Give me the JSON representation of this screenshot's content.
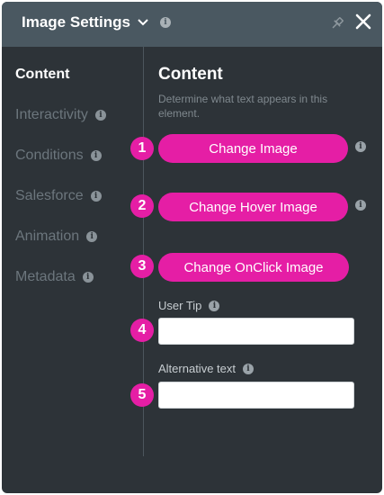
{
  "header": {
    "title": "Image Settings"
  },
  "sidebar": {
    "items": [
      {
        "label": "Content"
      },
      {
        "label": "Interactivity"
      },
      {
        "label": "Conditions"
      },
      {
        "label": "Salesforce"
      },
      {
        "label": "Animation"
      },
      {
        "label": "Metadata"
      }
    ]
  },
  "main": {
    "title": "Content",
    "description": "Determine what text appears in this element.",
    "steps": [
      "1",
      "2",
      "3",
      "4",
      "5"
    ],
    "buttons": {
      "change_image": "Change Image",
      "change_hover_image": "Change Hover Image",
      "change_onclick_image": "Change OnClick Image"
    },
    "fields": {
      "user_tip_label": "User Tip",
      "user_tip_value": "",
      "alt_text_label": "Alternative text",
      "alt_text_value": ""
    }
  },
  "info_glyph": "i",
  "colors": {
    "panel_bg": "#2d3338",
    "header_bg": "#4a5861",
    "accent": "#e51ea5"
  },
  "icons": [
    "chevron-down-icon",
    "info-icon",
    "pin-icon",
    "close-icon"
  ]
}
